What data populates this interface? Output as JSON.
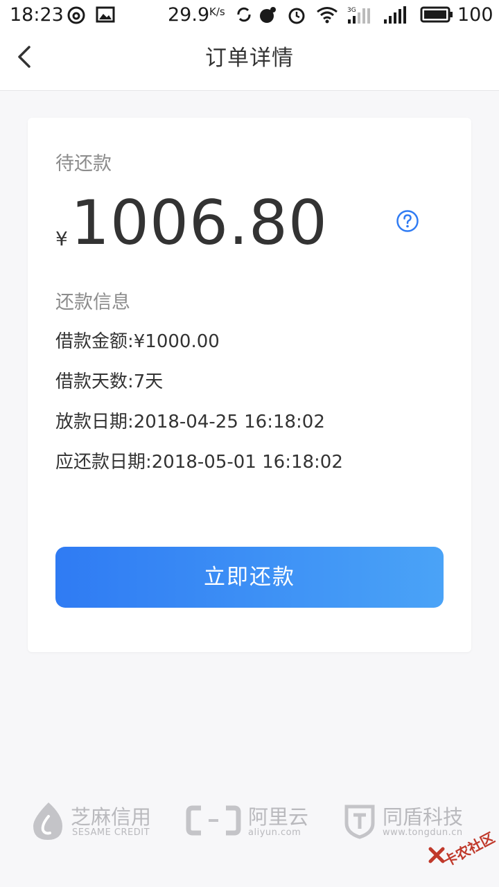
{
  "status_bar": {
    "time": "18:23",
    "speed": "29.9",
    "speed_unit": "K/s",
    "network_type": "3G",
    "battery": "100"
  },
  "nav": {
    "title": "订单详情"
  },
  "order": {
    "pending_label": "待还款",
    "currency_symbol": "¥",
    "amount": "1006.80",
    "info_title": "还款信息",
    "lines": [
      "借款金额:¥1000.00",
      "借款天数:7天",
      "放款日期:2018-04-25 16:18:02",
      "应还款日期:2018-05-01 16:18:02"
    ],
    "pay_button": "立即还款"
  },
  "footer": {
    "logos": [
      {
        "main": "芝麻信用",
        "sub": "SESAME CREDIT"
      },
      {
        "main": "阿里云",
        "sub": "aliyun.com"
      },
      {
        "main": "同盾科技",
        "sub": "www.tongdun.cn"
      }
    ],
    "watermark": "卡农社区"
  },
  "colors": {
    "accent_blue": "#2f7bf3",
    "accent_blue_light": "#4aa3f7",
    "label_gray": "#8c8c8c",
    "logo_gray": "#b9b9bd"
  }
}
